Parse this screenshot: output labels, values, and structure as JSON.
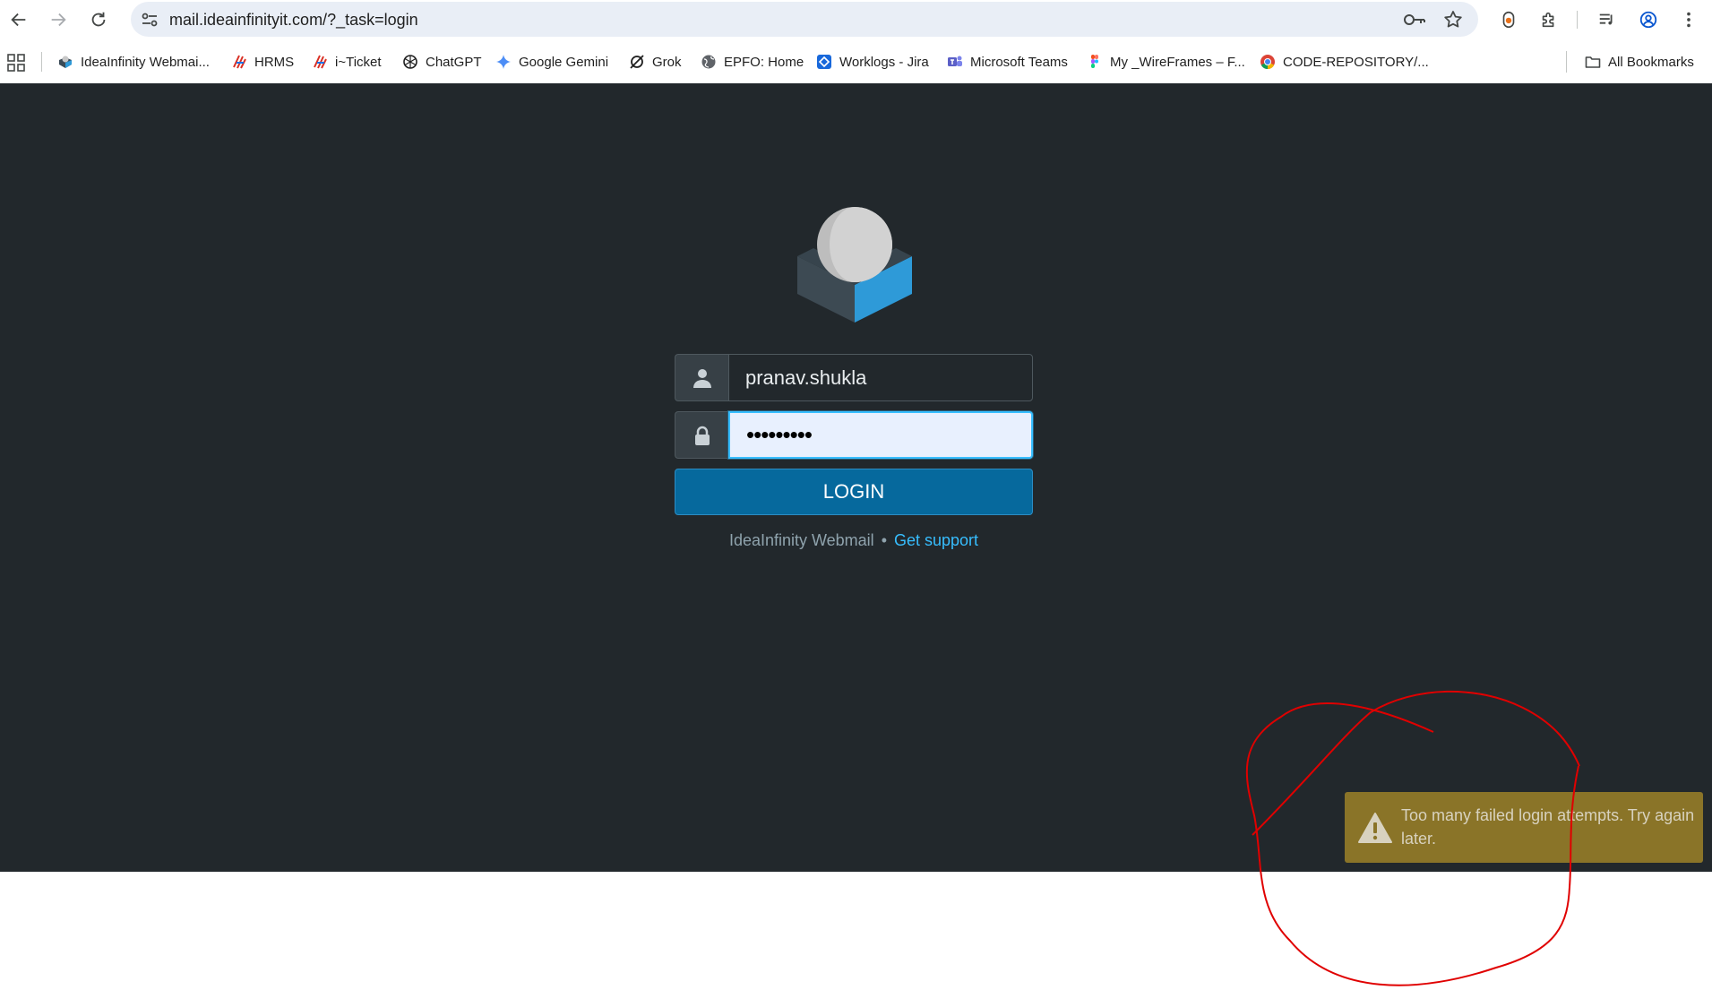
{
  "browser": {
    "url": "mail.ideainfinityit.com/?_task=login",
    "nav_icons": [
      "back-icon",
      "forward-icon",
      "reload-icon"
    ],
    "right_icons": [
      "password-key-icon",
      "bookmark-star-icon",
      "extension-icon",
      "puzzle-icon",
      "media-icon",
      "profile-icon",
      "menu-icon"
    ]
  },
  "bookmarks": {
    "items": [
      {
        "label": "IdeaInfinity Webmai...",
        "icon": "roundcube-icon"
      },
      {
        "label": "HRMS",
        "icon": "hrms-icon"
      },
      {
        "label": "i~Ticket",
        "icon": "ticket-icon"
      },
      {
        "label": "ChatGPT",
        "icon": "chatgpt-icon"
      },
      {
        "label": "Google Gemini",
        "icon": "gemini-icon"
      },
      {
        "label": "Grok",
        "icon": "grok-icon"
      },
      {
        "label": "EPFO: Home",
        "icon": "globe-icon"
      },
      {
        "label": "Worklogs - Jira",
        "icon": "jira-icon"
      },
      {
        "label": "Microsoft Teams",
        "icon": "teams-icon"
      },
      {
        "label": "My _WireFrames – F...",
        "icon": "figma-icon"
      },
      {
        "label": "CODE-REPOSITORY/...",
        "icon": "chrome-icon"
      }
    ],
    "all_bookmarks": "All Bookmarks"
  },
  "login": {
    "username_value": "pranav.shukla",
    "password_value": "•••••••••",
    "login_button": "LOGIN",
    "footer_product": "IdeaInfinity Webmail",
    "footer_separator": "•",
    "footer_link": "Get support"
  },
  "toast": {
    "message": "Too many failed login attempts. Try again later."
  },
  "colors": {
    "page_bg": "#22282c",
    "login_button": "#06699d",
    "link": "#37beff",
    "toast_bg": "#8a7428",
    "annotation": "#e00000"
  }
}
